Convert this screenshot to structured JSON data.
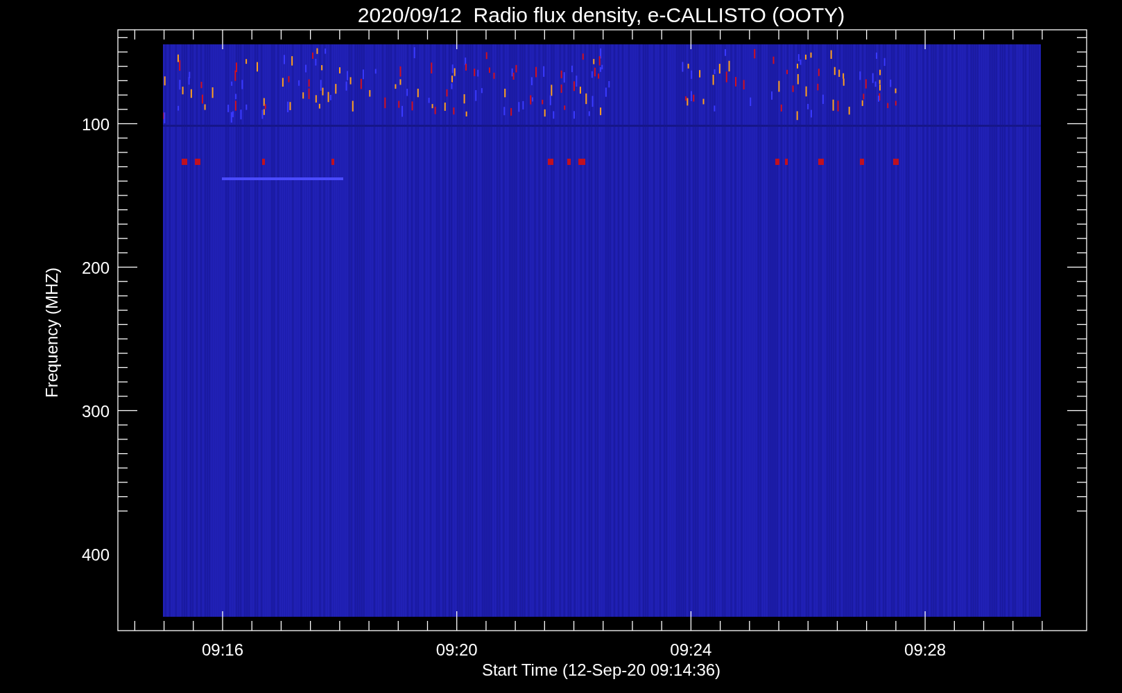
{
  "title": "2020/09/12  Radio flux density, e-CALLISTO (OOTY)",
  "ylabel": "Frequency (MHZ)",
  "xlabel": "Start Time (12-Sep-20 09:14:36)",
  "yticks": [
    "100",
    "200",
    "300",
    "400"
  ],
  "xticks": [
    "09:16",
    "09:20",
    "09:24",
    "09:28"
  ]
}
